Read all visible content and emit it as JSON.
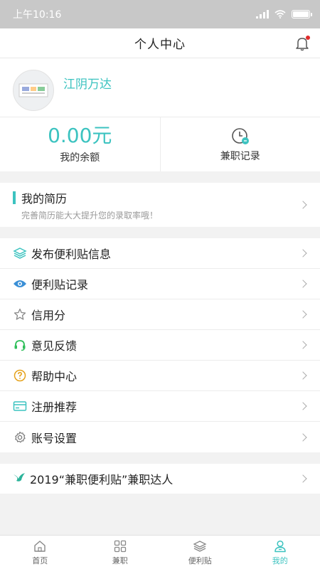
{
  "status_bar": {
    "time": "上午10:16"
  },
  "header": {
    "title": "个人中心"
  },
  "profile": {
    "name": "江阴万达"
  },
  "stats": {
    "balance_value": "0.00元",
    "balance_label": "我的余额",
    "records_label": "兼职记录"
  },
  "resume": {
    "title": "我的简历",
    "subtitle": "完善简历能大大提升您的录取率哦！"
  },
  "menu": [
    {
      "label": "发布便利贴信息",
      "icon": "layers-icon"
    },
    {
      "label": "便利贴记录",
      "icon": "eye-icon"
    },
    {
      "label": "信用分",
      "icon": "star-icon"
    },
    {
      "label": "意见反馈",
      "icon": "headset-icon"
    },
    {
      "label": "帮助中心",
      "icon": "question-icon"
    },
    {
      "label": "注册推荐",
      "icon": "card-icon"
    },
    {
      "label": "账号设置",
      "icon": "gear-icon"
    }
  ],
  "promo": {
    "label": "2019“兼职便利贴”兼职达人",
    "icon": "bird-icon"
  },
  "tabs": [
    {
      "label": "首页",
      "icon": "home-icon"
    },
    {
      "label": "兼职",
      "icon": "grid-icon"
    },
    {
      "label": "便利贴",
      "icon": "layers-icon"
    },
    {
      "label": "我的",
      "icon": "user-icon",
      "active": true
    }
  ],
  "colors": {
    "accent": "#3cc3c0",
    "status_bar": "#c8c8c8",
    "notification_dot": "#e02b2b"
  }
}
